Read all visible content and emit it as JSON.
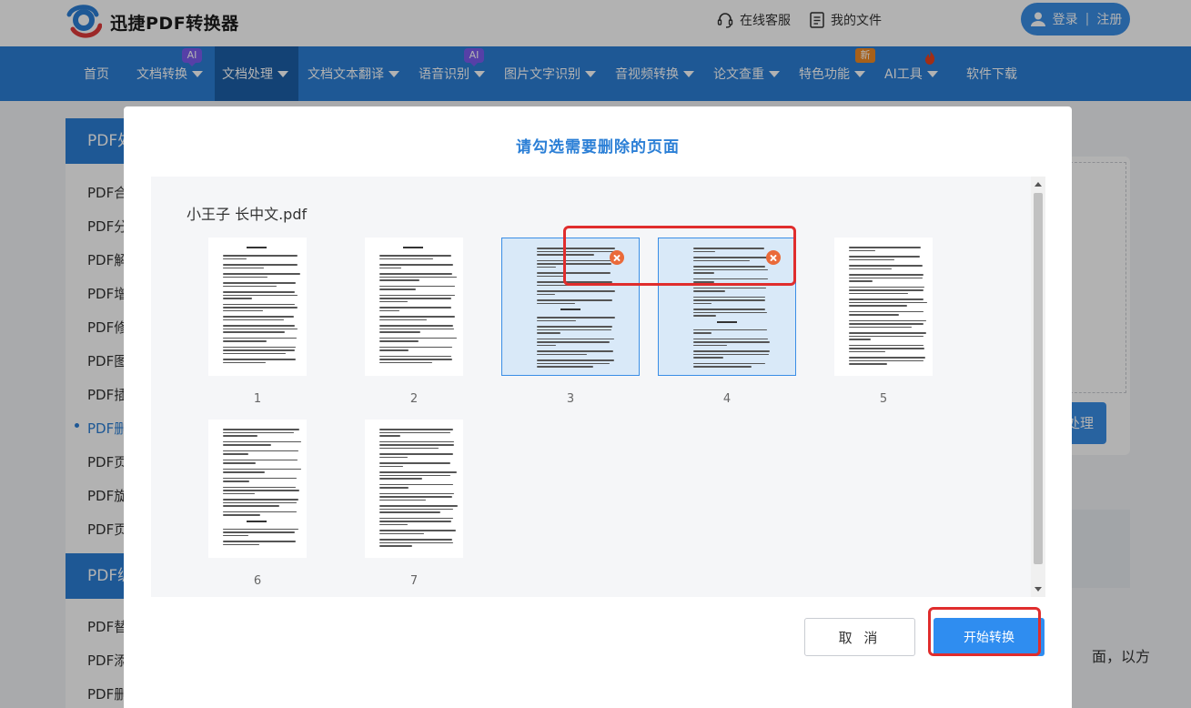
{
  "header": {
    "brand": "迅捷PDF转换器",
    "links": [
      {
        "label": "在线客服",
        "icon": "headset-icon"
      },
      {
        "label": "我的文件",
        "icon": "document-list-icon"
      }
    ],
    "login": {
      "login_label": "登录",
      "separator": "|",
      "register_label": "注册",
      "icon": "user-icon"
    }
  },
  "nav": {
    "items": [
      {
        "label": "首页"
      },
      {
        "label": "文档转换",
        "badge": "AI"
      },
      {
        "label": "文档处理",
        "active": true
      },
      {
        "label": "文档文本翻译"
      },
      {
        "label": "语音识别",
        "badge": "AI"
      },
      {
        "label": "图片文字识别"
      },
      {
        "label": "音视频转换"
      },
      {
        "label": "论文查重"
      },
      {
        "label": "特色功能",
        "badge": "新"
      },
      {
        "label": "AI工具",
        "badge_icon": "flame-icon"
      },
      {
        "label": "软件下载"
      }
    ]
  },
  "background": {
    "left_heads": [
      "PDF处理",
      "PDF编辑"
    ],
    "left_items": [
      "PDF合并",
      "PDF分割",
      "PDF解密",
      "PDF增加",
      "PDF修改",
      "PDF图片",
      "PDF插入",
      "PDF删除",
      "PDF页码",
      "PDF旋转",
      "PDF页面"
    ],
    "left_items_2": [
      "PDF替换",
      "PDF添加",
      "PDF删除"
    ],
    "right_button": "处理",
    "right_text": "面，以方"
  },
  "modal": {
    "title": "请勾选需要删除的页面",
    "file_name": "小王子 长中文.pdf",
    "pages": [
      {
        "number": "1",
        "selected": false
      },
      {
        "number": "2",
        "selected": false
      },
      {
        "number": "3",
        "selected": true
      },
      {
        "number": "4",
        "selected": true
      },
      {
        "number": "5",
        "selected": false
      },
      {
        "number": "6",
        "selected": false
      },
      {
        "number": "7",
        "selected": false
      }
    ],
    "cancel_label": "取 消",
    "start_label": "开始转换"
  },
  "colors": {
    "brand_blue": "#2b7fd6",
    "nav_active": "#1c5fa8",
    "button_blue": "#2f8df0",
    "annotation_red": "#e02d2d",
    "delete_orange": "#ea6a3a"
  }
}
